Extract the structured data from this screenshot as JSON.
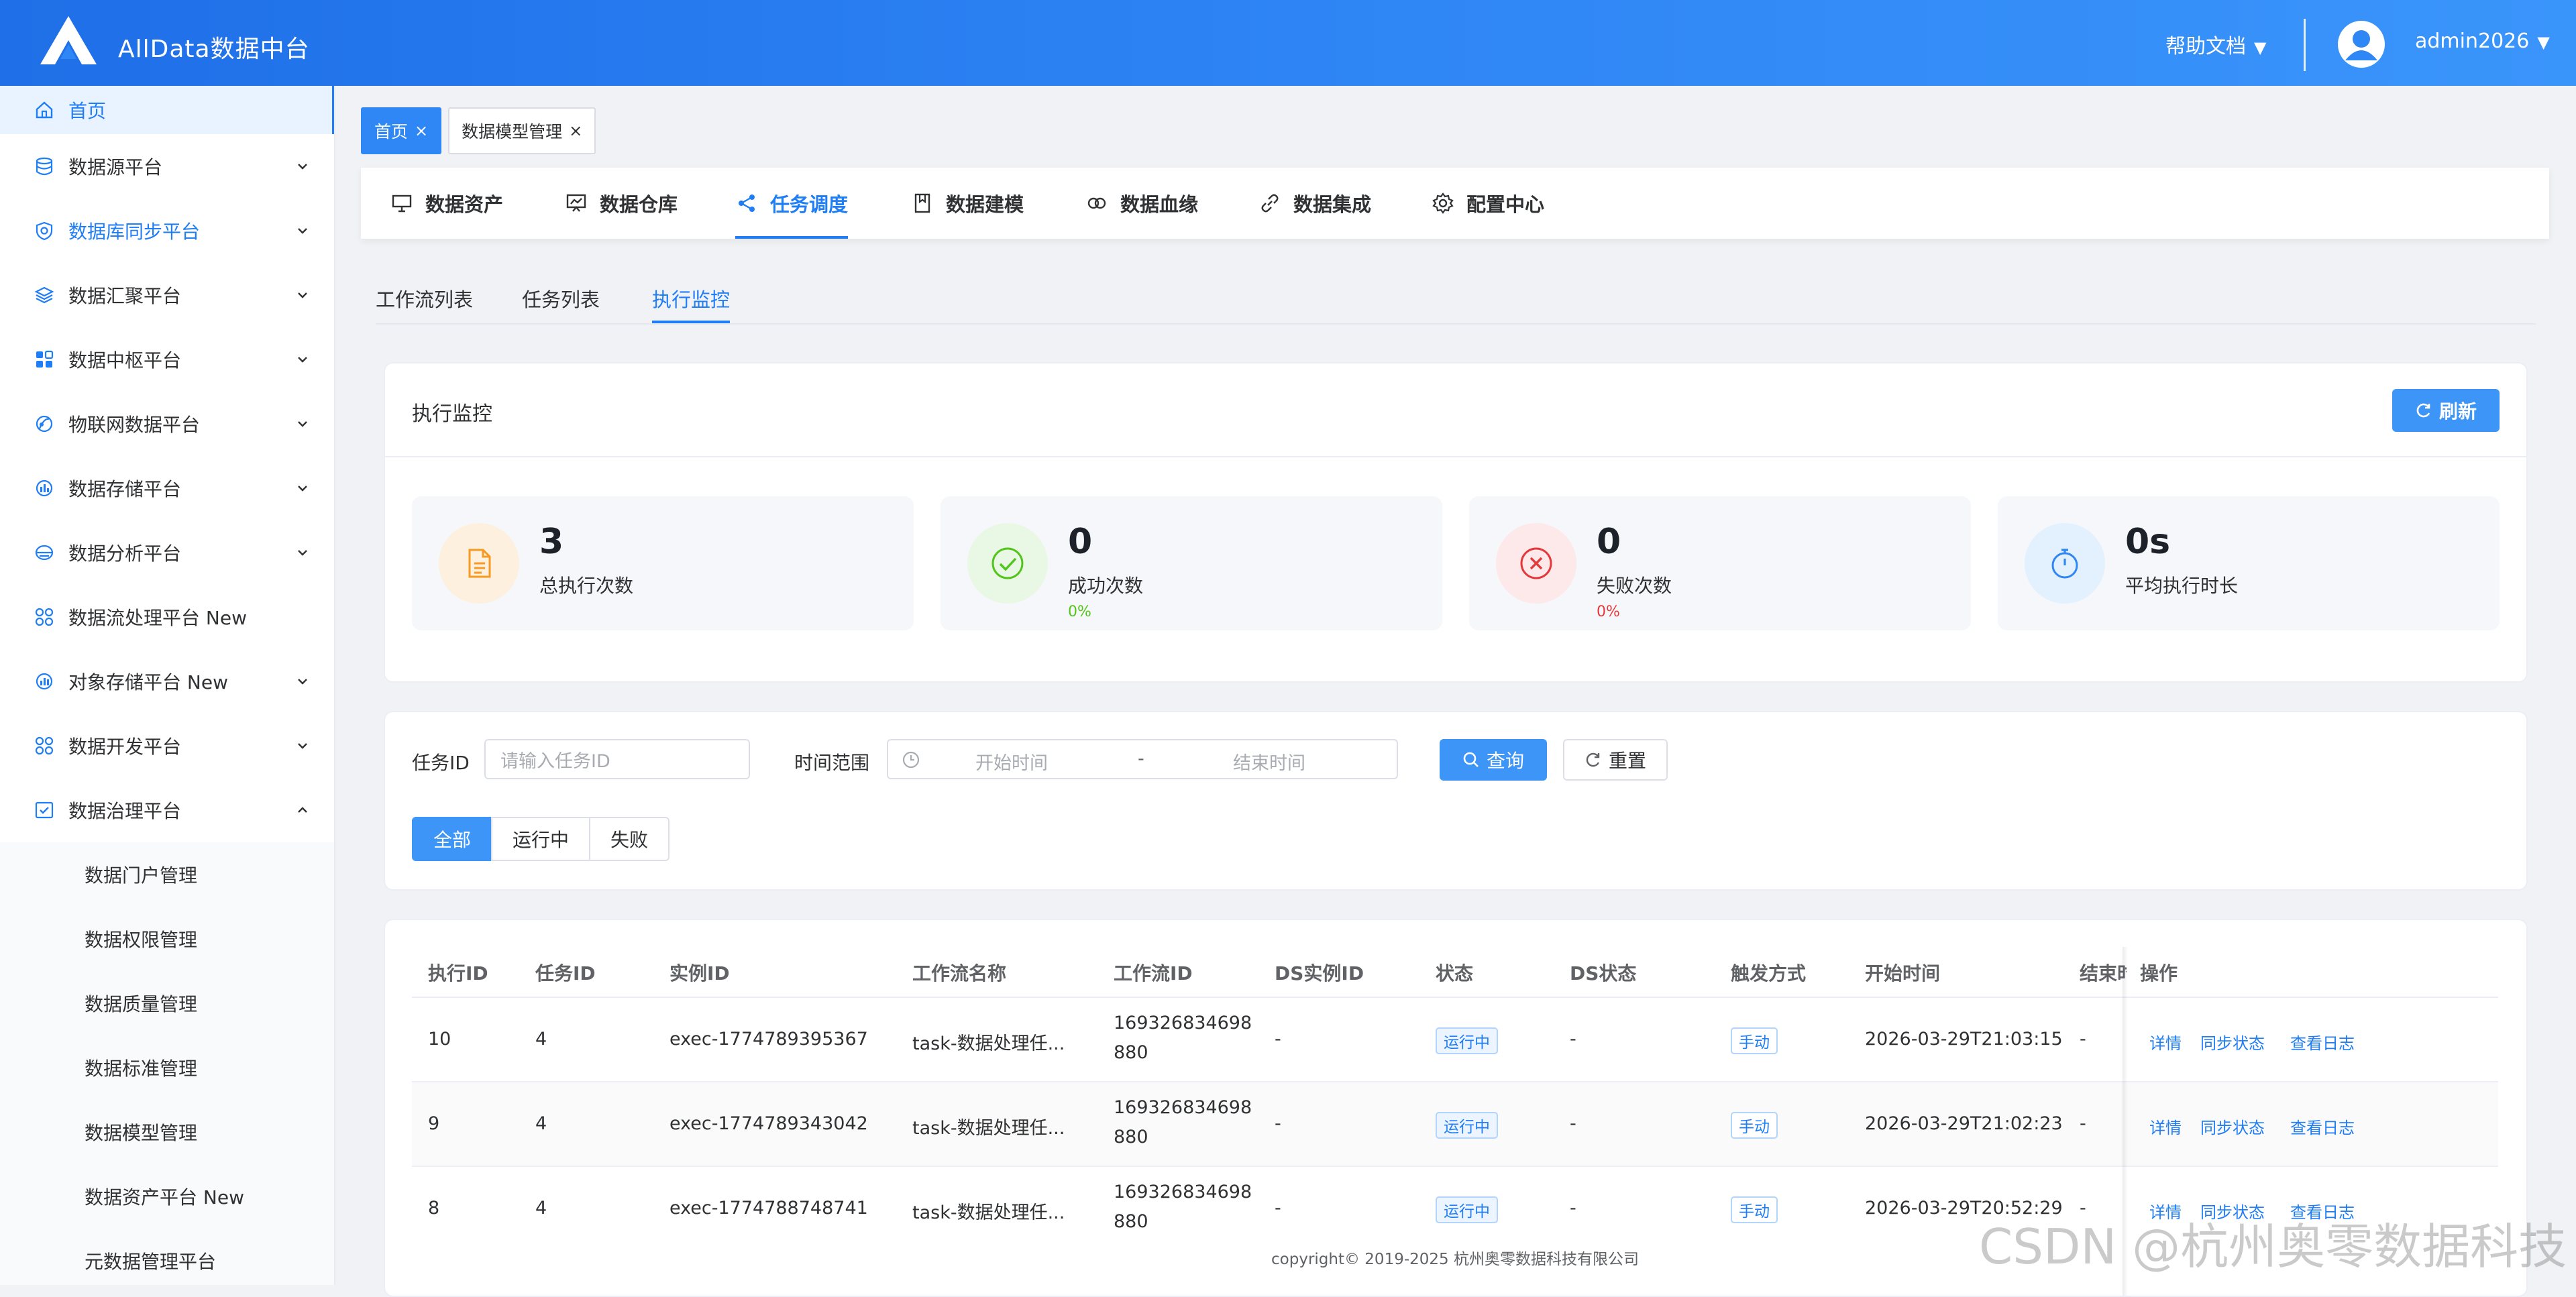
{
  "header": {
    "app_title": "AllData数据中台",
    "help_label": "帮助文档",
    "username": "admin2026",
    "caret": "▼",
    "logo_icon": "alldata-logo-icon",
    "avatar_icon": "user-avatar-icon"
  },
  "sidebar": {
    "items": [
      {
        "label": "首页",
        "icon": "home-icon",
        "active": true
      },
      {
        "label": "数据源平台",
        "icon": "database-icon"
      },
      {
        "label": "数据库同步平台",
        "icon": "sync-shield-icon",
        "accent": true
      },
      {
        "label": "数据汇聚平台",
        "icon": "layers-icon"
      },
      {
        "label": "数据中枢平台",
        "icon": "apps-icon"
      },
      {
        "label": "物联网数据平台",
        "icon": "iot-icon"
      },
      {
        "label": "数据存储平台",
        "icon": "storage-icon"
      },
      {
        "label": "数据分析平台",
        "icon": "analysis-icon"
      },
      {
        "label": "数据流处理平台 New",
        "icon": "grid-icon"
      },
      {
        "label": "对象存储平台 New",
        "icon": "object-storage-icon"
      },
      {
        "label": "数据开发平台",
        "icon": "grid-icon"
      },
      {
        "label": "数据治理平台",
        "icon": "governance-icon",
        "expanded": true
      }
    ],
    "sub_items": [
      "数据门户管理",
      "数据权限管理",
      "数据质量管理",
      "数据标准管理",
      "数据模型管理",
      "数据资产平台 New",
      "元数据管理平台"
    ]
  },
  "tags": [
    {
      "label": "首页",
      "close": "×"
    },
    {
      "label": "数据模型管理",
      "close": "×"
    }
  ],
  "module_nav": [
    {
      "label": "数据资产",
      "icon": "monitor-icon"
    },
    {
      "label": "数据仓库",
      "icon": "chart-board-icon"
    },
    {
      "label": "任务调度",
      "icon": "share-icon",
      "active": true
    },
    {
      "label": "数据建模",
      "icon": "bookmark-icon"
    },
    {
      "label": "数据血缘",
      "icon": "lineage-icon"
    },
    {
      "label": "数据集成",
      "icon": "link-icon"
    },
    {
      "label": "配置中心",
      "icon": "gear-icon"
    }
  ],
  "sub_tabs": [
    {
      "label": "工作流列表"
    },
    {
      "label": "任务列表"
    },
    {
      "label": "执行监控",
      "active": true
    }
  ],
  "monitor": {
    "title": "执行监控",
    "refresh_label": "刷新",
    "stats": [
      {
        "value": "3",
        "label": "总执行次数",
        "sub": "",
        "icon": "document-icon",
        "color": "#f59a23"
      },
      {
        "value": "0",
        "label": "成功次数",
        "sub": "0%",
        "icon": "check-circle-icon",
        "color": "#52c41a"
      },
      {
        "value": "0",
        "label": "失败次数",
        "sub": "0%",
        "icon": "close-circle-icon",
        "color": "#e5383b"
      },
      {
        "value": "0s",
        "label": "平均执行时长",
        "sub": "",
        "icon": "stopwatch-icon",
        "color": "#2f86f5"
      }
    ]
  },
  "filter": {
    "task_id_label": "任务ID",
    "task_id_placeholder": "请输入任务ID",
    "time_range_label": "时间范围",
    "start_placeholder": "开始时间",
    "range_sep": "-",
    "end_placeholder": "结束时间",
    "query_label": "查询",
    "reset_label": "重置",
    "status_segments": [
      {
        "label": "全部",
        "active": true
      },
      {
        "label": "运行中"
      },
      {
        "label": "失败"
      }
    ]
  },
  "table": {
    "columns": [
      "执行ID",
      "任务ID",
      "实例ID",
      "工作流名称",
      "工作流ID",
      "DS实例ID",
      "状态",
      "DS状态",
      "触发方式",
      "开始时间",
      "结束时",
      "操作"
    ],
    "rows": [
      {
        "exec_id": "10",
        "task_id": "4",
        "instance_id": "exec-1774789395367",
        "workflow_name": "task-数据处理任...",
        "workflow_id_1": "169326834698",
        "workflow_id_2": "880",
        "ds_instance_id": "-",
        "status": "运行中",
        "ds_status": "-",
        "trigger": "手动",
        "start_time": "2026-03-29T21:03:15",
        "end_time": "-"
      },
      {
        "exec_id": "9",
        "task_id": "4",
        "instance_id": "exec-1774789343042",
        "workflow_name": "task-数据处理任...",
        "workflow_id_1": "169326834698",
        "workflow_id_2": "880",
        "ds_instance_id": "-",
        "status": "运行中",
        "ds_status": "-",
        "trigger": "手动",
        "start_time": "2026-03-29T21:02:23",
        "end_time": "-"
      },
      {
        "exec_id": "8",
        "task_id": "4",
        "instance_id": "exec-1774788748741",
        "workflow_name": "task-数据处理任...",
        "workflow_id_1": "169326834698",
        "workflow_id_2": "880",
        "ds_instance_id": "-",
        "status": "运行中",
        "ds_status": "-",
        "trigger": "手动",
        "start_time": "2026-03-29T20:52:29",
        "end_time": "-"
      }
    ],
    "actions": [
      "详情",
      "同步状态",
      "查看日志"
    ]
  },
  "footer": "copyright© 2019-2025 杭州奥零数据科技有限公司",
  "watermark": "CSDN @杭州奥零数据科技"
}
